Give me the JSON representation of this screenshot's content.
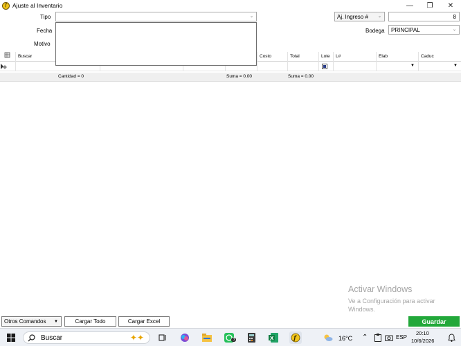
{
  "window": {
    "title": "Ajuste al Inventario",
    "minimize": "—",
    "restore": "❐",
    "close": "✕"
  },
  "form": {
    "tipo_label": "Tipo",
    "tipo_value": "",
    "fecha_label": "Fecha",
    "motivo_label": "Motivo",
    "doc_type": "Aj. Ingreso #",
    "doc_number": "8",
    "bodega_label": "Bodega",
    "bodega_value": "PRINCIPAL"
  },
  "grid": {
    "columns": [
      "Buscar",
      "Costo",
      "Total",
      "Lote",
      "L#",
      "Elab",
      "Caduc"
    ],
    "footer": {
      "cantidad": "Cantidad = 0",
      "suma_costo": "Suma = 0.00",
      "suma_total": "Suma = 0.00"
    }
  },
  "watermark": {
    "title": "Activar Windows",
    "subtitle": "Ve a Configuración para activar Windows."
  },
  "actions": {
    "otros_comandos": "Otros Comandos",
    "cargar_todo": "Cargar Todo",
    "cargar_excel": "Cargar Excel",
    "guardar": "Guardar"
  },
  "taskbar": {
    "search_placeholder": "Buscar",
    "whatsapp_badge": "3",
    "temperature": "16°C",
    "language": "ESP",
    "time": "20:10",
    "date": "10/6/2026"
  },
  "colors": {
    "save_button": "#22a83a",
    "watermark": "#a6a6a6"
  }
}
